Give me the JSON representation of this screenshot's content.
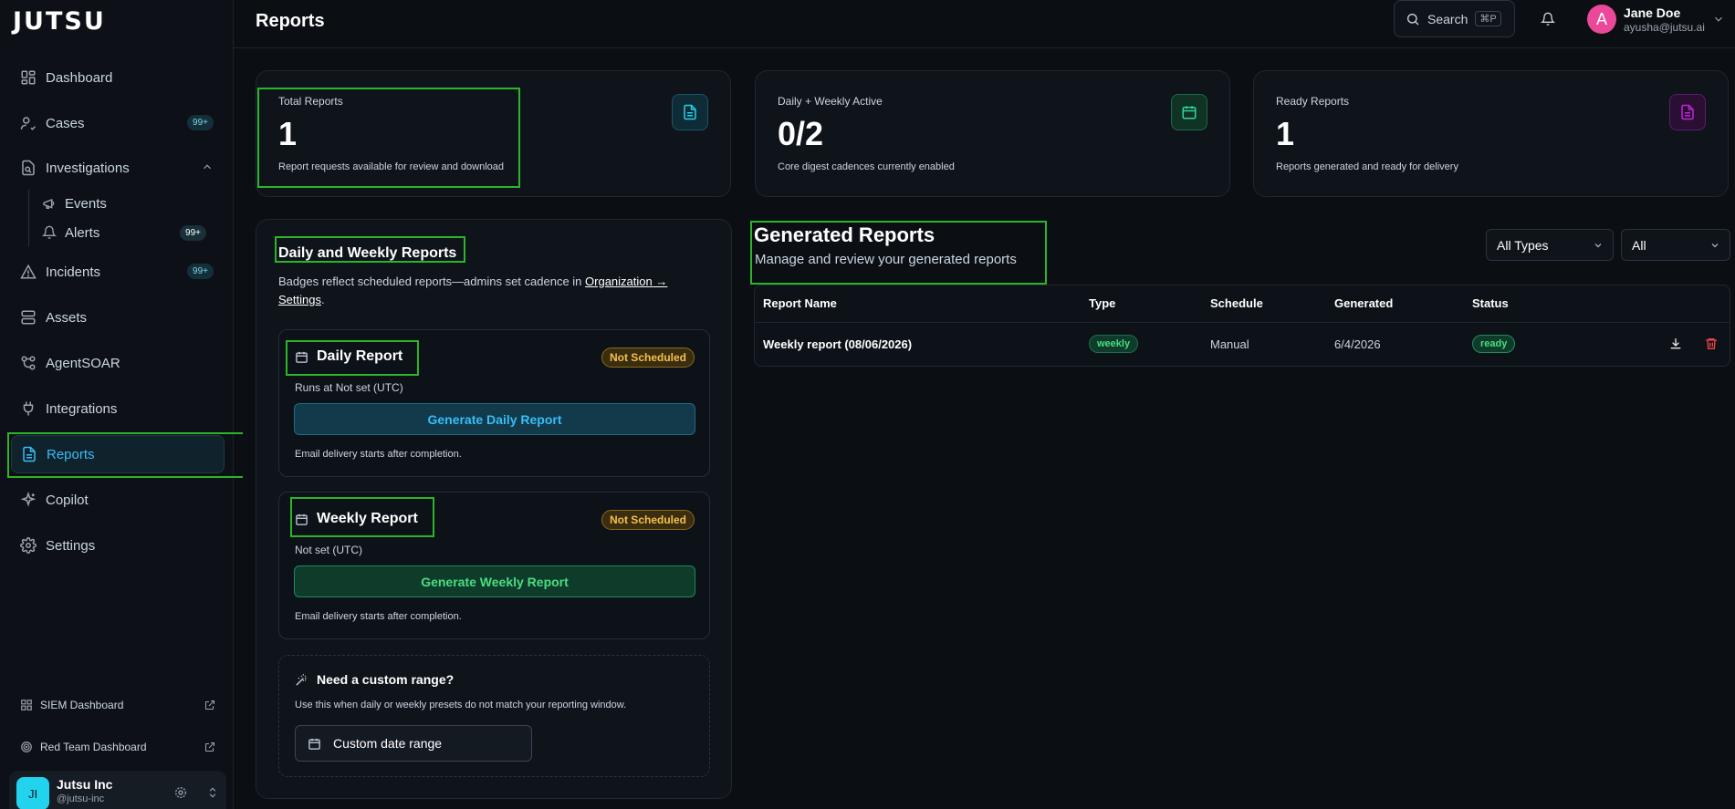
{
  "app": {
    "logo": "JUTSU",
    "page_title": "Reports"
  },
  "sidebar": {
    "items": [
      {
        "label": "Dashboard",
        "icon": "dashboard-icon"
      },
      {
        "label": "Cases",
        "icon": "cases-icon",
        "badge": "99+"
      },
      {
        "label": "Investigations",
        "icon": "investigations-icon"
      },
      {
        "label": "Events",
        "icon": "megaphone-icon"
      },
      {
        "label": "Alerts",
        "icon": "bell-icon",
        "badge": "99+"
      },
      {
        "label": "Incidents",
        "icon": "warning-icon",
        "badge": "99+"
      },
      {
        "label": "Assets",
        "icon": "server-icon"
      },
      {
        "label": "AgentSOAR",
        "icon": "agent-icon"
      },
      {
        "label": "Integrations",
        "icon": "plug-icon"
      },
      {
        "label": "Reports",
        "icon": "report-icon",
        "active": true
      },
      {
        "label": "Copilot",
        "icon": "sparkle-icon"
      },
      {
        "label": "Settings",
        "icon": "gear-icon"
      }
    ],
    "bottom_links": [
      {
        "label": "SIEM Dashboard",
        "icon": "grid-icon"
      },
      {
        "label": "Red Team Dashboard",
        "icon": "target-icon"
      }
    ],
    "org": {
      "initials": "JI",
      "name": "Jutsu Inc",
      "handle": "@jutsu-inc"
    }
  },
  "topbar": {
    "search_label": "Search",
    "search_shortcut": "⌘P",
    "user": {
      "initial": "A",
      "name": "Jane Doe",
      "email": "ayusha@jutsu.ai"
    }
  },
  "stats": [
    {
      "label": "Total Reports",
      "value": "1",
      "desc": "Report requests available for review and download",
      "icon": "file-text-icon",
      "color": "#22d3ee"
    },
    {
      "label": "Daily + Weekly Active",
      "value": "0/2",
      "desc": "Core digest cadences currently enabled",
      "icon": "calendar-icon",
      "color": "#34d399"
    },
    {
      "label": "Ready Reports",
      "value": "1",
      "desc": "Reports generated and ready for delivery",
      "icon": "file-check-icon",
      "color": "#c026d3"
    }
  ],
  "schedule_panel": {
    "title": "Daily and Weekly Reports",
    "desc_prefix": "Badges reflect scheduled reports—admins set cadence in ",
    "desc_link": "Organization → Settings",
    "desc_suffix": ".",
    "daily": {
      "title": "Daily Report",
      "badge": "Not Scheduled",
      "runs": "Runs at Not set (UTC)",
      "button": "Generate Daily Report",
      "note": "Email delivery starts after completion."
    },
    "weekly": {
      "title": "Weekly Report",
      "badge": "Not Scheduled",
      "runs": "Not set (UTC)",
      "button": "Generate Weekly Report",
      "note": "Email delivery starts after completion."
    },
    "custom": {
      "title": "Need a custom range?",
      "desc": "Use this when daily or weekly presets do not match your reporting window.",
      "button": "Custom date range"
    }
  },
  "generated": {
    "title": "Generated Reports",
    "subtitle": "Manage and review your generated reports",
    "type_filter": "All Types",
    "status_filter": "All",
    "columns": [
      "Report Name",
      "Type",
      "Schedule",
      "Generated",
      "Status"
    ],
    "rows": [
      {
        "name": "Weekly report (08/06/2026)",
        "type": "weekly",
        "schedule": "Manual",
        "generated": "6/4/2026",
        "status": "ready"
      }
    ]
  }
}
